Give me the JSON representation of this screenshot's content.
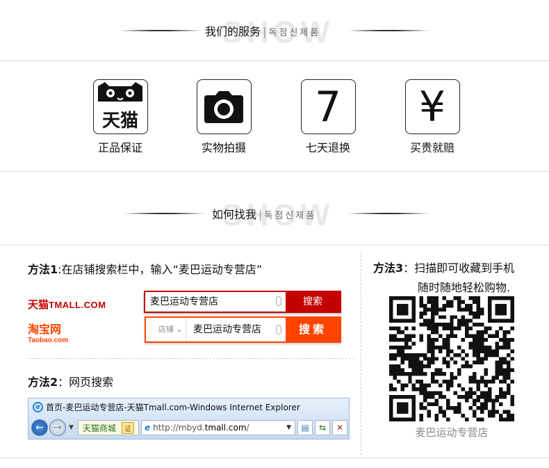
{
  "service": {
    "title": "我们的服务",
    "sep": "|",
    "kr": "독점신제품",
    "ghost": "SHOW",
    "items": [
      {
        "icon": "tmall-cat-icon",
        "icon_text": "天猫",
        "label": "正品保证"
      },
      {
        "icon": "camera-icon",
        "label": "实物拍摄"
      },
      {
        "icon": "seven-icon",
        "icon_text": "7",
        "label": "七天退换"
      },
      {
        "icon": "yen-icon",
        "icon_text": "¥",
        "label": "买贵就赔"
      }
    ]
  },
  "find": {
    "title": "如何找我",
    "sep": "|",
    "kr": "독점신제품",
    "ghost": "SHOW"
  },
  "method1": {
    "label": "方法1",
    "text": ":在店铺搜索栏中，输入“麦巴运动专营店”",
    "tmall_logo_zh": "天猫",
    "tmall_logo_en": "TMALL.COM",
    "tmall_search_value": "麦巴运动专营店",
    "tmall_search_button": "搜索",
    "taobao_logo_zh": "淘宝网",
    "taobao_logo_en": "Taobao.com",
    "taobao_select": "店铺",
    "taobao_search_value": "麦巴运动专营店",
    "taobao_search_button": "搜索"
  },
  "method2": {
    "label": "方法2",
    "text": "：网页搜索",
    "ie_title": "首页-麦巴运动专营店-天猫Tmall.com-Windows Internet Explorer",
    "favorite_label": "天猫商城",
    "cert_label": "证",
    "address_prefix": "http://mbyd.",
    "address_domain": "tmall.com",
    "address_suffix": "/"
  },
  "method3": {
    "label": "方法3",
    "text_line1": "：扫描即可收藏到手机",
    "text_line2": "随时随地轻松购物.",
    "qr_caption": "麦巴运动专营店"
  },
  "colors": {
    "tmall_red": "#c40000",
    "taobao_orange": "#ff4400"
  }
}
